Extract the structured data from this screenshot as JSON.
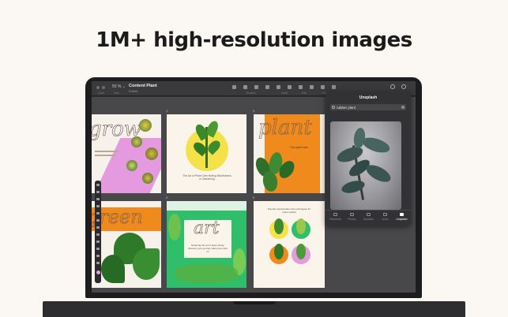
{
  "headline": "1M+ high-resolution images",
  "toolbar": {
    "zoom": "50 % ⌄",
    "title": "Content Plant",
    "subtitle": "Edited"
  },
  "subtabs": [
    "Zoom",
    "View",
    "Boolean",
    "Insert",
    "Edit",
    "Share",
    "Wrap",
    "Inspect"
  ],
  "cards": [
    {
      "num": "",
      "word": "grow",
      "text": ""
    },
    {
      "num": "3",
      "word": "",
      "text": "The Art of Plant Care finding Mindfulness in Gardening"
    },
    {
      "num": "5",
      "word": "plant",
      "text": "Your plant care"
    },
    {
      "num": "",
      "word": "green",
      "text": ""
    },
    {
      "num": "5",
      "word": "art",
      "text": "Nurturing the art of plant caring: discover your journey starts here with us"
    },
    {
      "num": "6",
      "word": "",
      "text": "Popular tropical plant care techniques for indoor plants"
    }
  ],
  "panel": {
    "title": "Unsplash",
    "search_value": "rubber plant",
    "tabs": [
      "Elements",
      "Photos",
      "Symbols",
      "Icons",
      "Unsplash"
    ],
    "active_tab": "Unsplash"
  },
  "colors": {
    "page_bg": "#fbf7f2",
    "accent_orange": "#f08a1c",
    "accent_pink": "#e59ae0",
    "accent_green": "#2fbf6a",
    "accent_yellow": "#f5e24a"
  }
}
